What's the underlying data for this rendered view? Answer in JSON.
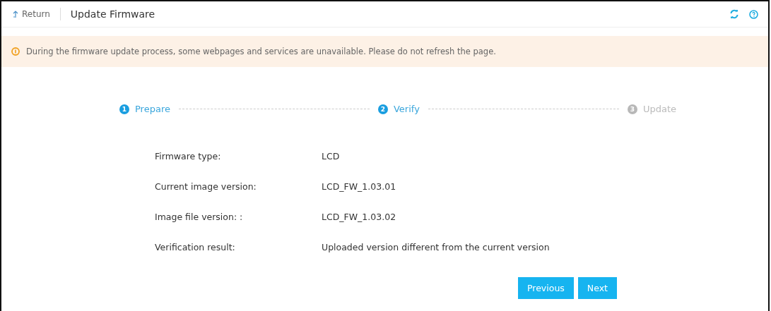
{
  "header": {
    "back_label": "Return",
    "title": "Update Firmware"
  },
  "notice": "During the firmware update process, some webpages and services are unavailable. Please do not refresh the page.",
  "steps": [
    {
      "number": "1",
      "label": "Prepare",
      "reached": true
    },
    {
      "number": "2",
      "label": "Verify",
      "reached": true
    },
    {
      "number": "3",
      "label": "Update",
      "reached": false
    }
  ],
  "details": [
    {
      "label": "Firmware type:",
      "value": "LCD"
    },
    {
      "label": "Current image version:",
      "value": "LCD_FW_1.03.01"
    },
    {
      "label": "Image file version: :",
      "value": "LCD_FW_1.03.02"
    },
    {
      "label": "Verification result:",
      "value": "Uploaded version different from the current version"
    }
  ],
  "buttons": [
    "Previous",
    "Next"
  ]
}
